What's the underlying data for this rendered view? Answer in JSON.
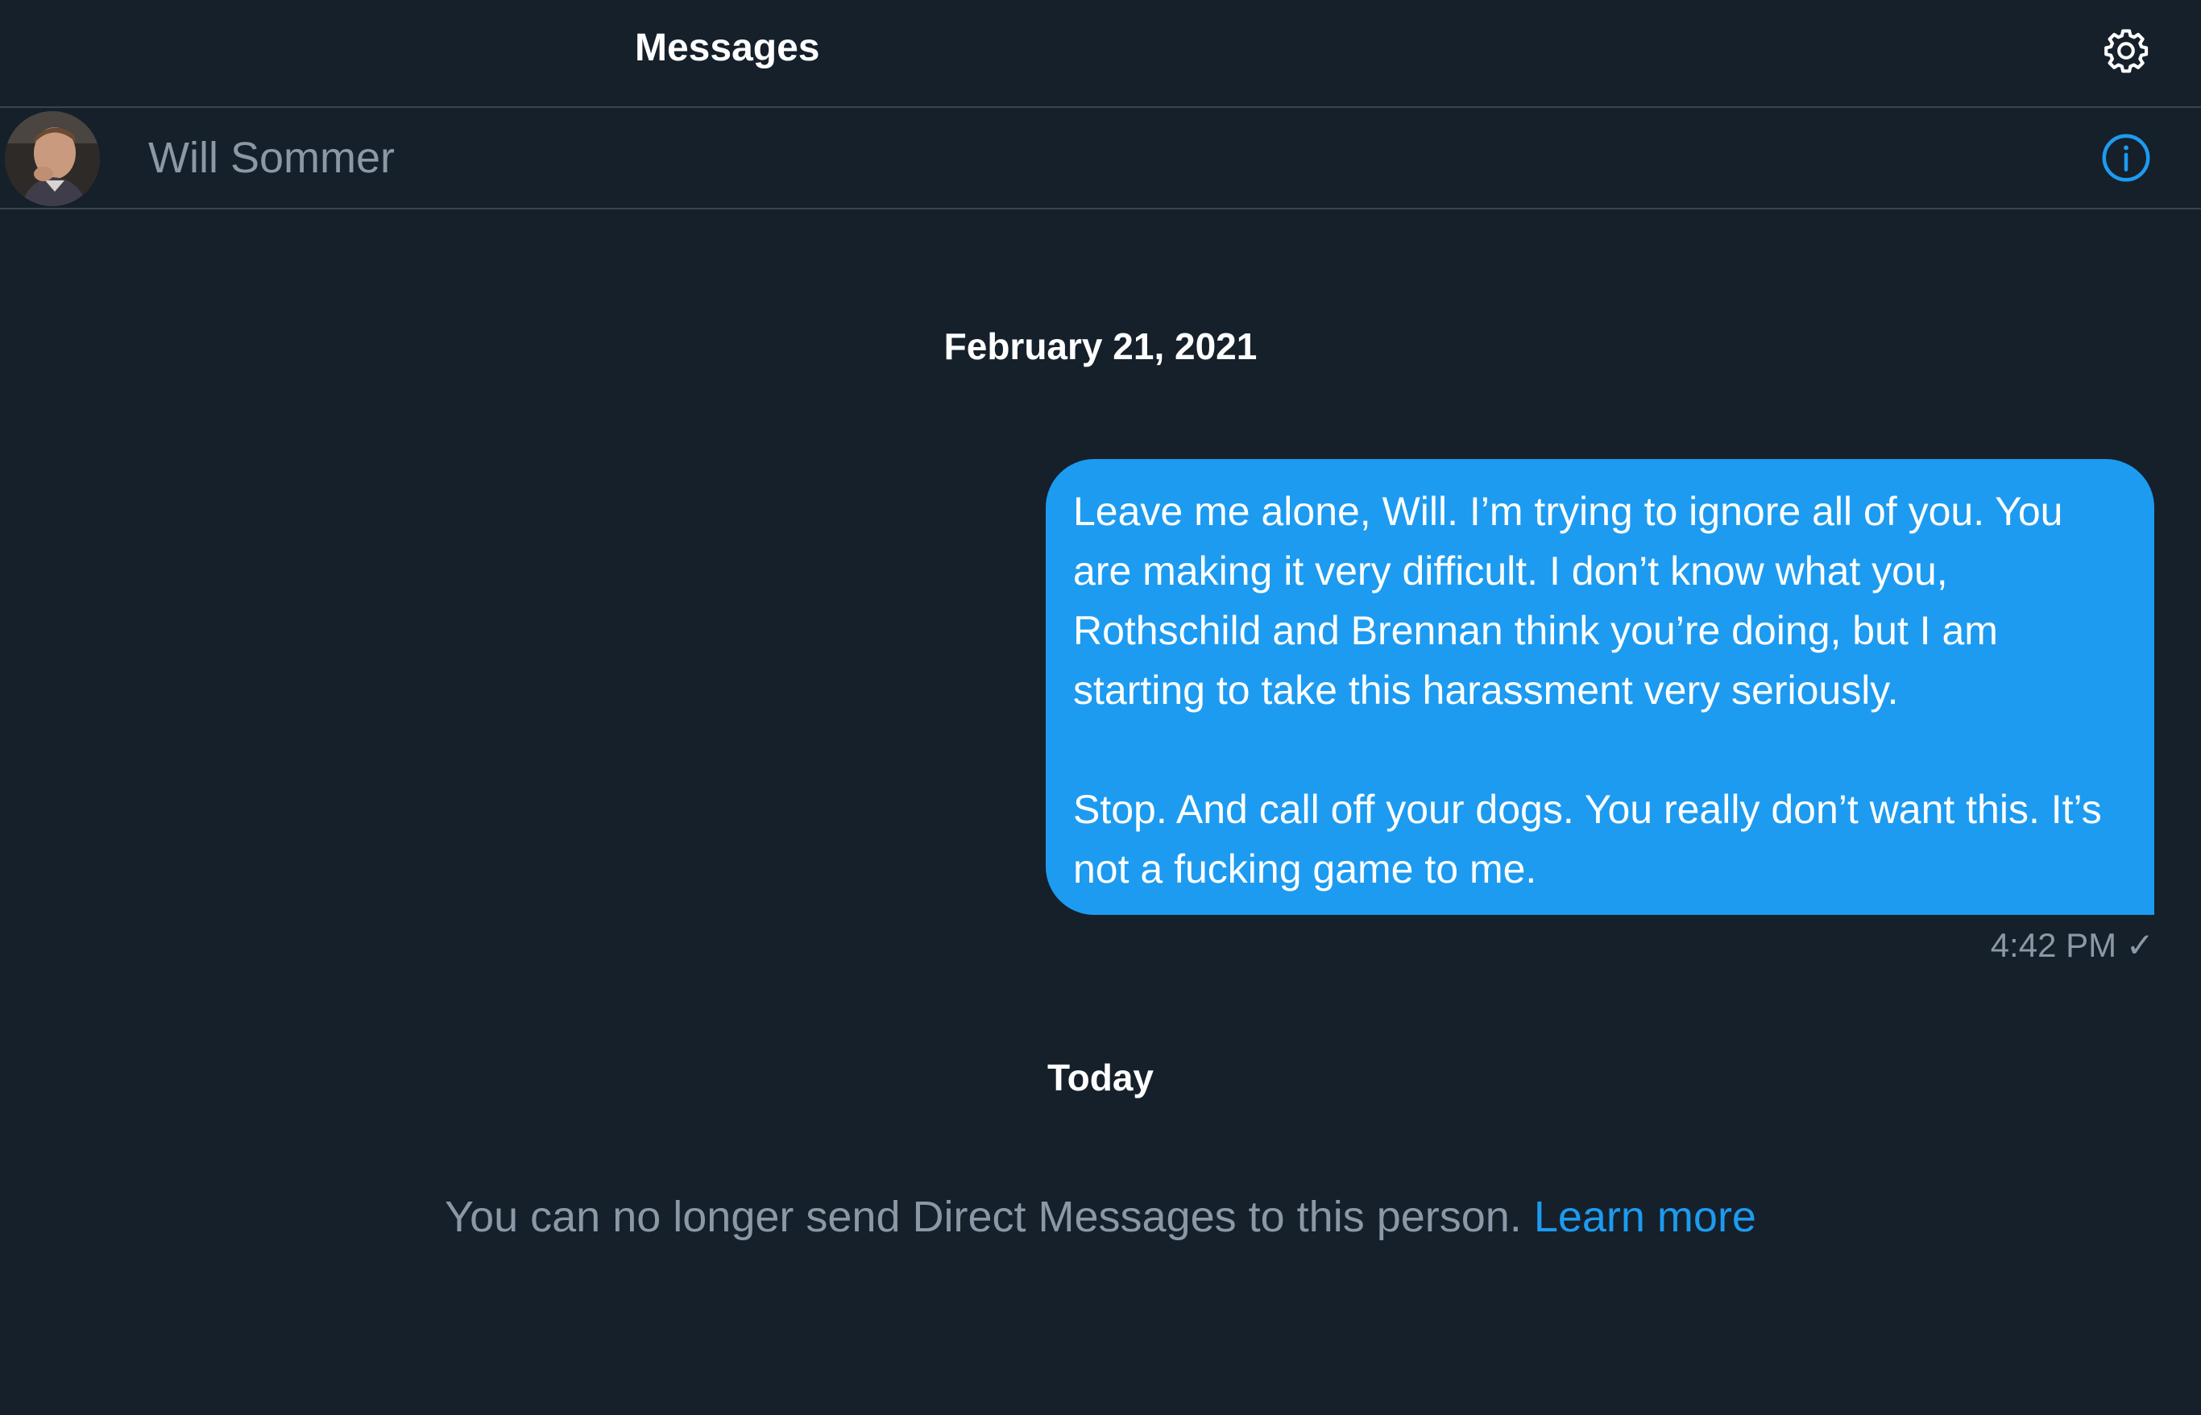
{
  "header": {
    "title": "Messages",
    "settings_icon": "gear-icon"
  },
  "conversation": {
    "contact_name": "Will Sommer",
    "avatar": "avatar-photo",
    "info_icon": "info-icon"
  },
  "thread": {
    "date_1": "February 21, 2021",
    "message_1": {
      "text": "Leave me alone, Will. I’m trying to ignore all of you. You are making it very difficult. I don’t know what you, Rothschild and Brennan think you’re doing, but I am starting to take this harassment very seriously.\n\nStop. And call off your dogs. You really don’t want this. It’s not a fucking game to me.",
      "time": "4:42 PM",
      "status_icon": "checkmark-icon"
    },
    "date_2": "Today",
    "notice_text": "You can no longer send Direct Messages to this person. ",
    "notice_link": "Learn more"
  },
  "colors": {
    "background": "#15202b",
    "bubble": "#1d9bf0",
    "muted_text": "#8b98a5",
    "accent": "#1d9bf0"
  }
}
